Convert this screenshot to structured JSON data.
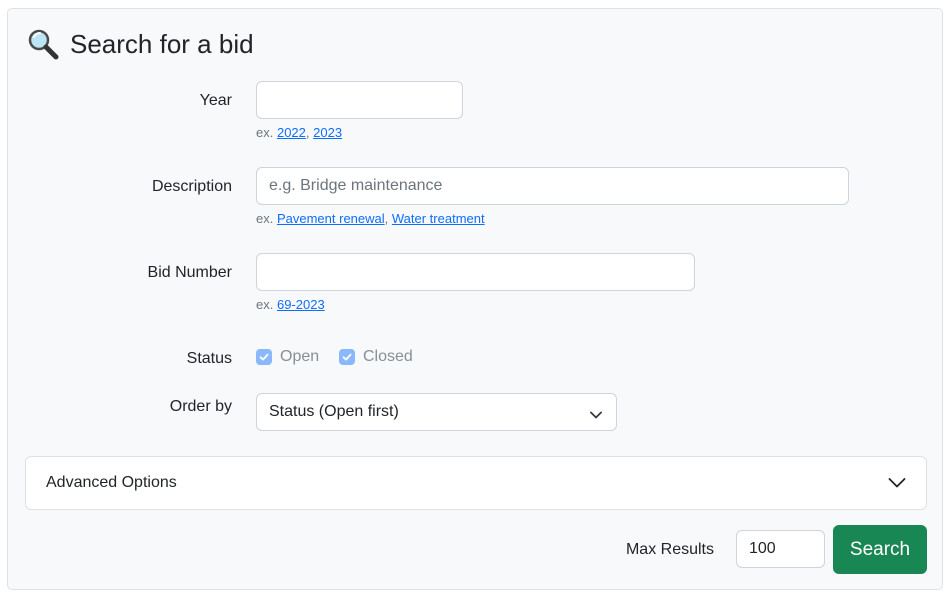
{
  "title": "Search for a bid",
  "title_icon": "magnifying-glass-icon",
  "fields": {
    "year": {
      "label": "Year",
      "value": "",
      "placeholder": "",
      "hint_prefix": "ex.",
      "examples": [
        "2022",
        "2023"
      ]
    },
    "description": {
      "label": "Description",
      "value": "",
      "placeholder": "e.g. Bridge maintenance",
      "hint_prefix": "ex.",
      "examples": [
        "Pavement renewal",
        "Water treatment"
      ]
    },
    "bid_number": {
      "label": "Bid Number",
      "value": "",
      "placeholder": "",
      "hint_prefix": "ex.",
      "examples": [
        "69-2023"
      ]
    },
    "status": {
      "label": "Status",
      "options": [
        {
          "label": "Open",
          "checked": true
        },
        {
          "label": "Closed",
          "checked": true
        }
      ]
    },
    "order_by": {
      "label": "Order by",
      "selected": "Status (Open first)"
    }
  },
  "advanced_options": {
    "label": "Advanced Options",
    "expanded": false
  },
  "footer": {
    "max_results_label": "Max Results",
    "max_results_value": "100",
    "search_label": "Search"
  },
  "colors": {
    "card_background": "#f8f9fa",
    "link": "#0d6efd",
    "checkbox_checked": "#6ea8fe",
    "search_button": "#198754"
  }
}
